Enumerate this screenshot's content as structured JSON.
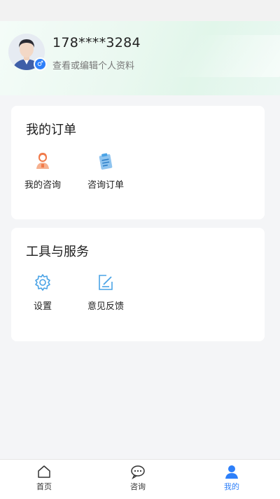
{
  "profile": {
    "phone": "178****3284",
    "edit_text": "查看或编辑个人资料",
    "gender_symbol": "♂"
  },
  "orders": {
    "title": "我的订单",
    "items": [
      {
        "label": "我的咨询",
        "icon": "consultant-person-icon"
      },
      {
        "label": "咨询订单",
        "icon": "order-clipboard-icon"
      }
    ]
  },
  "services": {
    "title": "工具与服务",
    "items": [
      {
        "label": "设置",
        "icon": "gear-icon"
      },
      {
        "label": "意见反馈",
        "icon": "feedback-edit-icon"
      }
    ]
  },
  "tabs": [
    {
      "label": "首页",
      "icon": "home-icon",
      "active": false
    },
    {
      "label": "咨询",
      "icon": "chat-icon",
      "active": false
    },
    {
      "label": "我的",
      "icon": "user-icon",
      "active": true
    }
  ],
  "colors": {
    "accent": "#2d7ff9",
    "orange": "#f07a4a",
    "icon_blue": "#4aa3e6"
  }
}
